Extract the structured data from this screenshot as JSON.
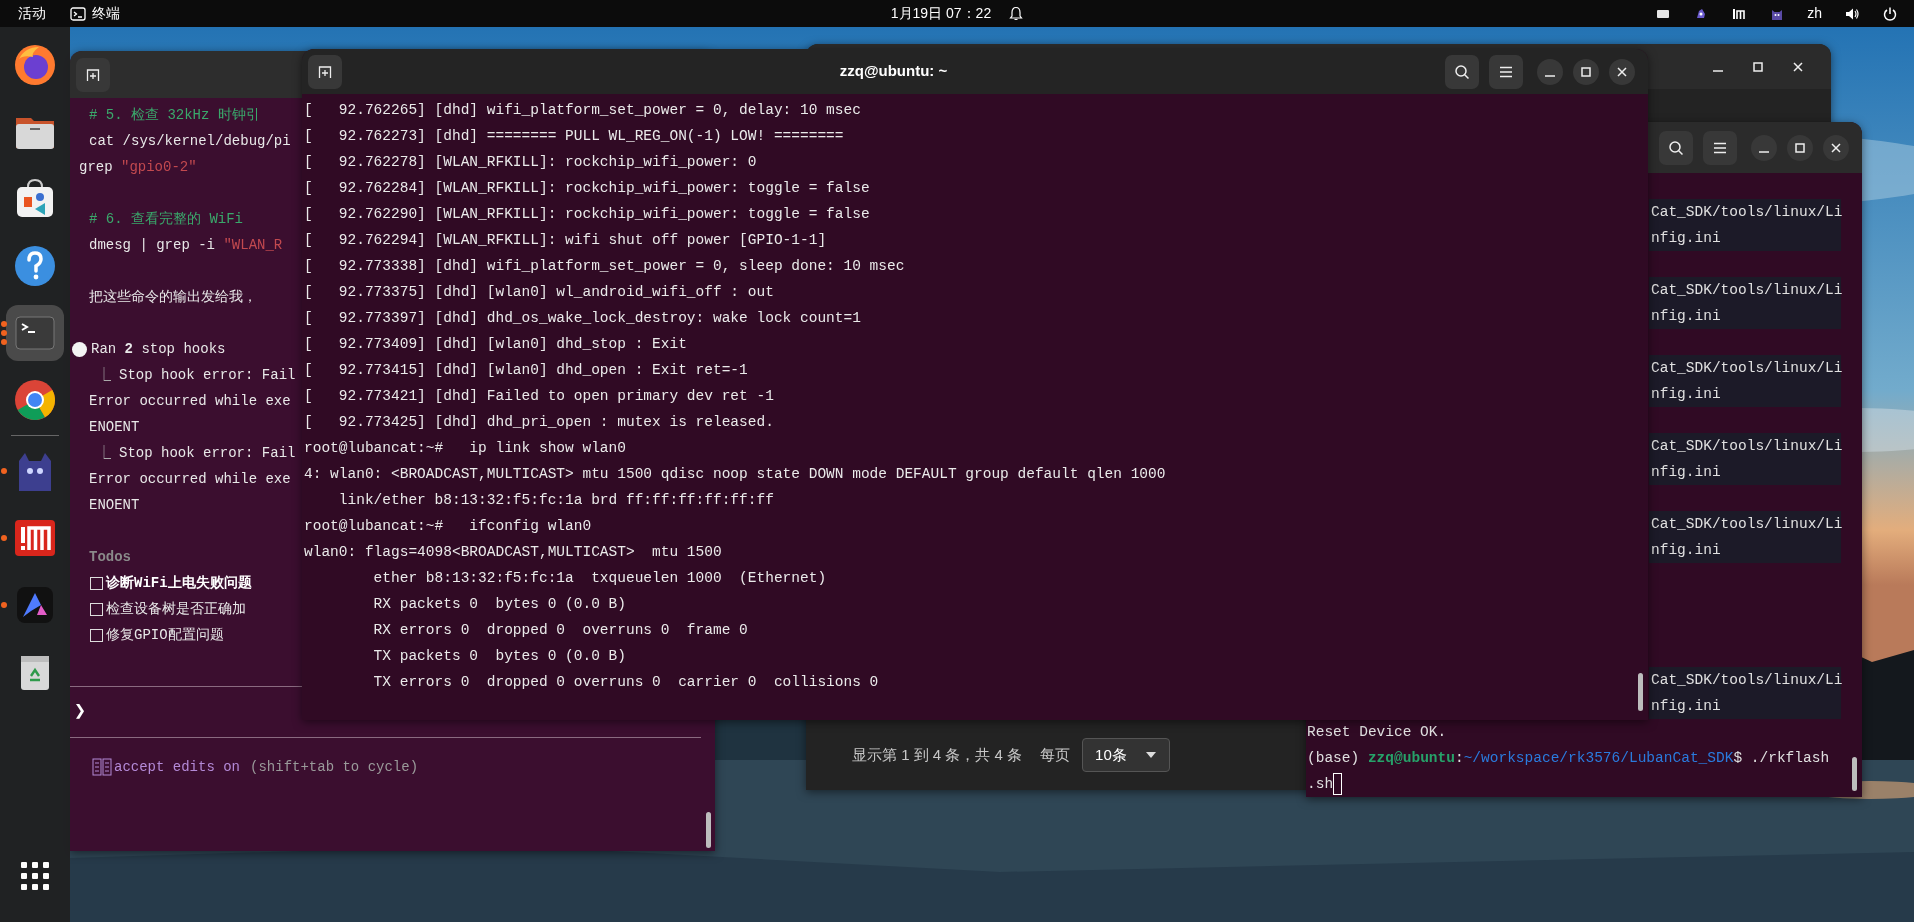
{
  "top_bar": {
    "activities": "活动",
    "app": {
      "name": "终端"
    },
    "clock": "1月19日 07：22",
    "tray": [
      {
        "kind": "display"
      },
      {
        "kind": "blob"
      },
      {
        "kind": "input"
      },
      {
        "kind": "cat"
      }
    ],
    "language": "zh"
  },
  "dock": {
    "items": [
      {
        "kind": "firefox",
        "running": false,
        "active": false
      },
      {
        "kind": "files",
        "running": false,
        "active": false
      },
      {
        "kind": "store",
        "running": false,
        "active": false
      },
      {
        "kind": "help",
        "running": false,
        "active": false
      },
      {
        "kind": "terminal",
        "running": true,
        "multiple_windows": true,
        "active": true
      },
      {
        "kind": "chrome",
        "running": false,
        "active": false
      },
      {
        "kind": "separator"
      },
      {
        "kind": "cat",
        "running": true,
        "multiple_windows": false,
        "active": false
      },
      {
        "kind": "im",
        "running": true,
        "multiple_windows": false,
        "active": false
      },
      {
        "kind": "a_app",
        "running": true,
        "multiple_windows": false,
        "active": false
      },
      {
        "kind": "trash",
        "running": false,
        "active": false
      },
      {
        "kind": "apps"
      }
    ]
  },
  "back_window": {
    "pagination": {
      "summary": "显示第 1 到 4 条，共 4 条",
      "per_page_label": "每页",
      "per_page": "10条"
    }
  },
  "assistant_window": {
    "lines": [
      {
        "kind": "comment",
        "text": "# 5. 检查 32kHz 时钟引"
      },
      {
        "kind": "command",
        "segments": [
          {
            "kind": "plain",
            "text": "cat /sys/kernel/debug/pi"
          }
        ]
      },
      {
        "kind": "continuation",
        "segments": [
          {
            "kind": "plain",
            "text": "grep "
          },
          {
            "kind": "string",
            "text": "\"gpio0-2\""
          }
        ]
      },
      {
        "kind": "comment",
        "text": "# 6. 查看完整的 WiFi",
        "space_before": true
      },
      {
        "kind": "command",
        "segments": [
          {
            "kind": "plain",
            "text": "dmesg | grep -i "
          },
          {
            "kind": "string",
            "text": "\"WLAN_R"
          }
        ]
      },
      {
        "kind": "message",
        "text": "把这些命令的输出发给我，",
        "space_before": true
      },
      {
        "kind": "bullet",
        "text": "Ran **2** stop hooks",
        "space_before": true
      },
      {
        "kind": "branch",
        "marker": "⎿",
        "text": "Stop hook error: Fail"
      },
      {
        "kind": "error",
        "text": "Error occurred while exe"
      },
      {
        "kind": "error",
        "text": "ENOENT"
      },
      {
        "kind": "branch",
        "marker": "⎿",
        "text": "Stop hook error: Fail"
      },
      {
        "kind": "error",
        "text": "Error occurred while exe"
      },
      {
        "kind": "error",
        "text": "ENOENT"
      },
      {
        "kind": "heading",
        "text": "Todos",
        "space_before": true
      },
      {
        "kind": "todo",
        "text": "诊断WiFi上电失败问题",
        "checked": false,
        "in_progress": true
      },
      {
        "kind": "todo",
        "text": "检查设备树是否正确加",
        "checked": false,
        "in_progress": false
      },
      {
        "kind": "todo",
        "text": "修复GPIO配置问题",
        "checked": false,
        "in_progress": false
      }
    ],
    "prompt": "❯",
    "status": {
      "mode": "accept edits on",
      "hint": "(shift+tab to cycle)"
    }
  },
  "right_terminal": {
    "partial_groups": [
      [
        "Cat_SDK/tools/linux/Li",
        "nfig.ini"
      ],
      [
        "Cat_SDK/tools/linux/Li",
        "nfig.ini"
      ],
      [
        "Cat_SDK/tools/linux/Li",
        "nfig.ini"
      ],
      [
        "Cat_SDK/tools/linux/Li",
        "nfig.ini"
      ],
      [
        "Cat_SDK/tools/linux/Li",
        "nfig.ini"
      ],
      [
        "Cat_SDK/tools/linux/Li",
        "nfig.ini"
      ]
    ],
    "lines": [
      {
        "segments": [
          {
            "kind": "plain",
            "text": "Reset Device OK."
          }
        ],
        "cursor": false
      },
      {
        "segments": [
          {
            "kind": "plain",
            "text": "(base) "
          },
          {
            "kind": "user",
            "text": "zzq@ubuntu"
          },
          {
            "kind": "plain",
            "text": ":"
          },
          {
            "kind": "path",
            "text": "~/workspace/rk3576/LubanCat_SDK"
          },
          {
            "kind": "plain",
            "text": "$ ./rkflash"
          }
        ],
        "cursor": false
      },
      {
        "segments": [
          {
            "kind": "plain",
            "text": ".sh"
          }
        ],
        "cursor": true
      }
    ]
  },
  "main_terminal": {
    "title": "zzq@ubuntu: ~",
    "lines": [
      "[   92.762265] [dhd] wifi_platform_set_power = 0, delay: 10 msec",
      "[   92.762273] [dhd] ======== PULL WL_REG_ON(-1) LOW! ========",
      "[   92.762278] [WLAN_RFKILL]: rockchip_wifi_power: 0",
      "[   92.762284] [WLAN_RFKILL]: rockchip_wifi_power: toggle = false",
      "[   92.762290] [WLAN_RFKILL]: rockchip_wifi_power: toggle = false",
      "[   92.762294] [WLAN_RFKILL]: wifi shut off power [GPIO-1-1]",
      "[   92.773338] [dhd] wifi_platform_set_power = 0, sleep done: 10 msec",
      "[   92.773375] [dhd] [wlan0] wl_android_wifi_off : out",
      "[   92.773397] [dhd] dhd_os_wake_lock_destroy: wake lock count=1",
      "[   92.773409] [dhd] [wlan0] dhd_stop : Exit",
      "[   92.773415] [dhd] [wlan0] dhd_open : Exit ret=-1",
      "[   92.773421] [dhd] Failed to open primary dev ret -1",
      "[   92.773425] [dhd] dhd_pri_open : mutex is released.",
      "root@lubancat:~#   ip link show wlan0",
      "4: wlan0: <BROADCAST,MULTICAST> mtu 1500 qdisc noop state DOWN mode DEFAULT group default qlen 1000",
      "    link/ether b8:13:32:f5:fc:1a brd ff:ff:ff:ff:ff:ff",
      "root@lubancat:~#   ifconfig wlan0",
      "wlan0: flags=4098<BROADCAST,MULTICAST>  mtu 1500",
      "        ether b8:13:32:f5:fc:1a  txqueuelen 1000  (Ethernet)",
      "        RX packets 0  bytes 0 (0.0 B)",
      "        RX errors 0  dropped 0  overruns 0  frame 0",
      "        TX packets 0  bytes 0 (0.0 B)",
      "        TX errors 0  dropped 0 overruns 0  carrier 0  collisions 0"
    ]
  }
}
